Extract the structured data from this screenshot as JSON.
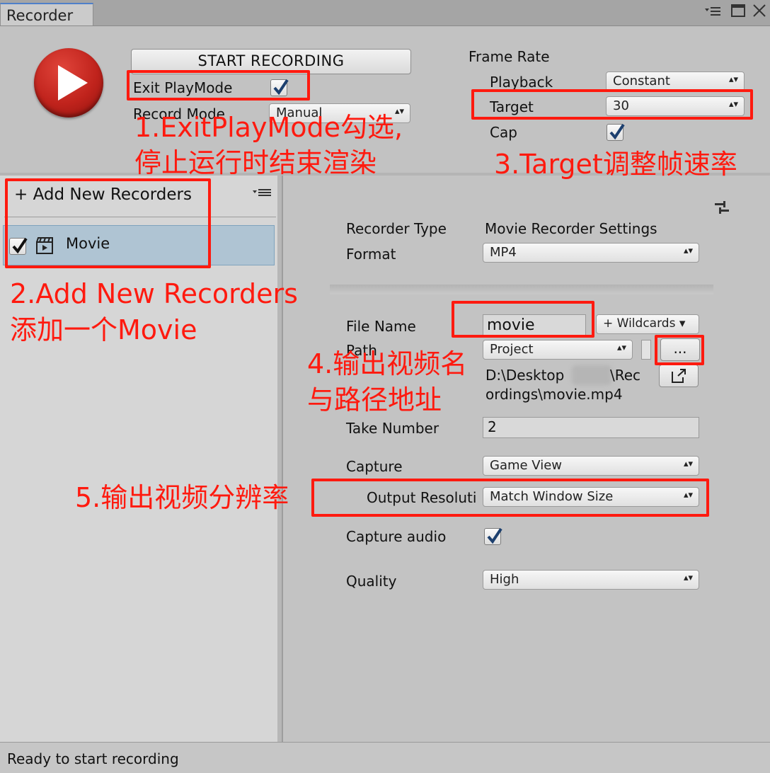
{
  "window": {
    "tab_title": "Recorder",
    "menu_icon": "menu-icon",
    "maximize_icon": "maximize-icon",
    "close_icon": "close-icon"
  },
  "controls": {
    "start_button": "START RECORDING",
    "exit_playmode_label": "Exit PlayMode",
    "exit_playmode_checked": true,
    "record_mode_label": "Record Mode",
    "record_mode_value": "Manual",
    "frame_rate_heading": "Frame Rate",
    "playback_label": "Playback",
    "playback_value": "Constant",
    "target_label": "Target",
    "target_value": "30",
    "cap_label": "Cap",
    "cap_checked": true
  },
  "recorder_list": {
    "add_button": "+ Add New Recorders",
    "items": [
      {
        "label": "Movie",
        "enabled": true
      }
    ]
  },
  "settings": {
    "recorder_type_label": "Recorder Type",
    "recorder_type_value": "Movie Recorder Settings",
    "format_label": "Format",
    "format_value": "MP4",
    "file_name_label": "File Name",
    "file_name_value": "movie",
    "wildcards_button": "+ Wildcards ▾",
    "path_label": "Path",
    "path_value": "Project",
    "browse_button": "...",
    "path_display_prefix": "D:\\Desktop",
    "path_display_suffix": "\\Rec",
    "path_display_line2": "ordings\\movie.mp4",
    "take_number_label": "Take Number",
    "take_number_value": "2",
    "capture_label": "Capture",
    "capture_value": "Game View",
    "output_resolution_label": "Output Resoluti",
    "output_resolution_value": "Match Window Size",
    "capture_audio_label": "Capture audio",
    "capture_audio_checked": true,
    "quality_label": "Quality",
    "quality_value": "High"
  },
  "status": {
    "text": "Ready to start recording"
  },
  "annotations": {
    "a1_line1": "1.ExitPlayMode勾选,",
    "a1_line2": "停止运行时结束渲染",
    "a2_line1": "2.Add New Recorders",
    "a2_line2": "添加一个Movie",
    "a3": "3.Target调整帧速率",
    "a4_line1": "4.输出视频名",
    "a4_line2": "与路径地址",
    "a5": "5.输出视频分辨率",
    "color": "#ff1a0f"
  }
}
